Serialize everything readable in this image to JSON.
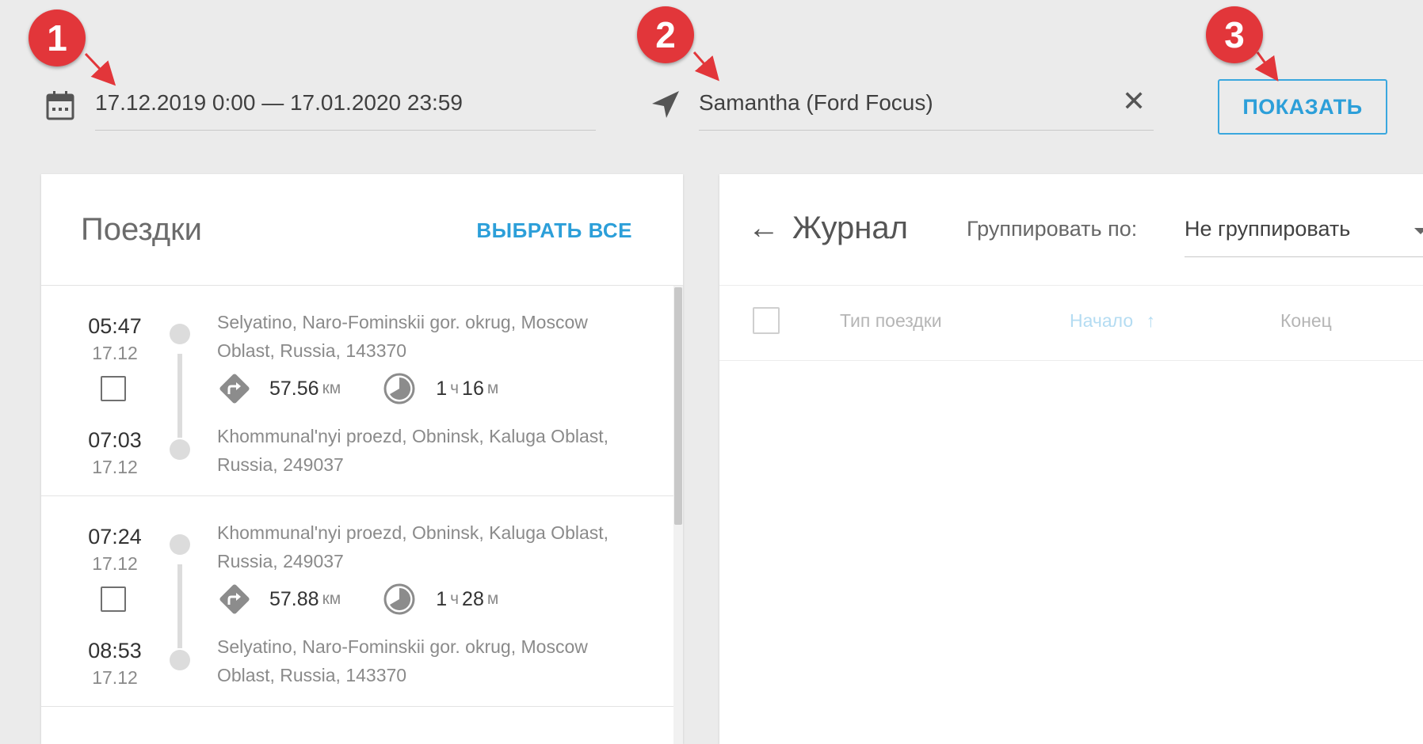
{
  "filters": {
    "period": "17.12.2019 0:00 — 17.01.2020 23:59",
    "vehicle": "Samantha (Ford Focus)",
    "clear_symbol": "✕",
    "show_label": "ПОКАЗАТЬ",
    "calendar_icon": "calendar-icon",
    "navigation_icon": "navigation-arrow-icon"
  },
  "markers": [
    "1",
    "2",
    "3"
  ],
  "colors": {
    "accent": "#2c9fd9",
    "marker": "#e2363a",
    "background": "#ebebeb"
  },
  "trips_panel": {
    "title": "Поездки",
    "select_all": "ВЫБРАТЬ ВСЕ",
    "trips": [
      {
        "start_time": "05:47",
        "start_date": "17.12",
        "end_time": "07:03",
        "end_date": "17.12",
        "from": "Selyatino, Naro-Fominskii gor. okrug, Moscow Oblast, Russia, 143370",
        "to": "Khommunal'nyi proezd, Obninsk, Kaluga Oblast, Russia, 249037",
        "distance": "57.56",
        "distance_unit": "км",
        "hours": "1",
        "hours_unit": "ч",
        "minutes": "16",
        "minutes_unit": "м"
      },
      {
        "start_time": "07:24",
        "start_date": "17.12",
        "end_time": "08:53",
        "end_date": "17.12",
        "from": "Khommunal'nyi proezd, Obninsk, Kaluga Oblast, Russia, 249037",
        "to": "Selyatino, Naro-Fominskii gor. okrug, Moscow Oblast, Russia, 143370",
        "distance": "57.88",
        "distance_unit": "км",
        "hours": "1",
        "hours_unit": "ч",
        "minutes": "28",
        "minutes_unit": "м"
      }
    ]
  },
  "journal_panel": {
    "back_arrow": "←",
    "title": "Журнал",
    "group_by_label": "Группировать по:",
    "group_by_value": "Не группировать",
    "columns": [
      {
        "label": "Тип поездки"
      },
      {
        "label": "Начало",
        "sort_arrow": "↑"
      },
      {
        "label": "Конец"
      }
    ]
  }
}
